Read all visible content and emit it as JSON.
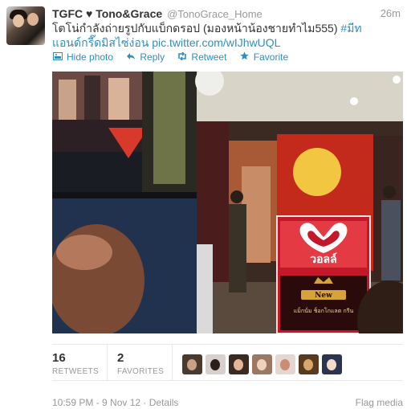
{
  "tweet": {
    "fullname": "TGFC ♥ Tono&Grace",
    "screenname": "@TonoGrace_Home",
    "time": "26m",
    "text_prefix": "โตโน่กำลังถ่ายรูปกับแบ็กดรอป (มองหน้าน้องชายทำไม555) ",
    "hashtag": "#มีทแอนด์กรี๊ดมิสไซ่ง่อน",
    "text_space": " ",
    "pic_link": "pic.twitter.com/wIJhwUQL"
  },
  "actions": {
    "hide_photo": "Hide photo",
    "reply": "Reply",
    "retweet": "Retweet",
    "favorite": "Favorite"
  },
  "photo": {
    "poster_brand": "วอลล์",
    "poster_tag": "New",
    "poster_sub": "แม็กนั่ม ช็อกโกแลต กรีน"
  },
  "stats": {
    "retweets_count": "16",
    "retweets_label": "RETWEETS",
    "favorites_count": "2",
    "favorites_label": "FAVORITES"
  },
  "favoriters": [
    {
      "name": "favoriter-avatar-1"
    },
    {
      "name": "favoriter-avatar-2"
    },
    {
      "name": "favoriter-avatar-3"
    },
    {
      "name": "favoriter-avatar-4"
    },
    {
      "name": "favoriter-avatar-5"
    },
    {
      "name": "favoriter-avatar-6"
    },
    {
      "name": "favoriter-avatar-7"
    }
  ],
  "footer": {
    "timestamp": "10:59 PM - 9 Nov 12",
    "separator": " · ",
    "details": "Details",
    "flag_media": "Flag media"
  },
  "colors": {
    "link": "#2f8fbd",
    "muted": "#999999",
    "text": "#333333",
    "poster_red": "#c4182a"
  },
  "icons": {
    "hide_photo": "photo-icon",
    "reply": "reply-arrow-icon",
    "retweet": "retweet-icon",
    "favorite": "star-icon"
  }
}
